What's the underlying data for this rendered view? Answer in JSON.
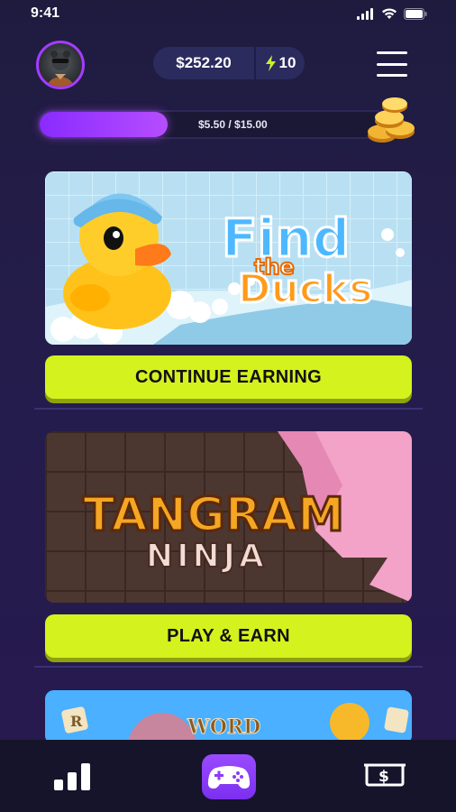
{
  "status": {
    "time": "9:41"
  },
  "header": {
    "balance": "$252.20",
    "energy": "10"
  },
  "progress": {
    "text": "$5.50 / $15.00",
    "fraction": 0.367
  },
  "games": [
    {
      "title_line1": "Find",
      "title_line2": "the",
      "title_line3": "Ducks",
      "cta": "CONTINUE EARNING"
    },
    {
      "title_line1": "TANGRAM",
      "title_line2": "NINJA",
      "cta": "PLAY & EARN"
    },
    {
      "title_line1": "WORD"
    }
  ],
  "nav": {
    "icons": [
      "stats-icon",
      "gamepad-icon",
      "cash-icon"
    ]
  },
  "colors": {
    "accent": "#d4f21e",
    "progress": "#8a2bff",
    "avatar_border": "#a43cff",
    "energy": "#c9f02b"
  }
}
